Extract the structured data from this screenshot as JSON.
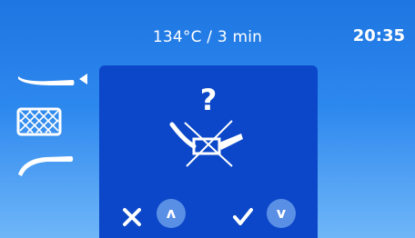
{
  "header": {
    "program": "134°C / 3 min",
    "clock": "20:35"
  },
  "sidebar": {
    "items": [
      {
        "icon": "instrument-icon",
        "selected": true
      },
      {
        "icon": "basket-icon",
        "selected": false
      },
      {
        "icon": "curved-instrument-icon",
        "selected": false
      }
    ]
  },
  "dialog": {
    "question": "?",
    "icon": "crossed-out-handpiece-icon",
    "up_label": "ʌ",
    "down_label": "v"
  },
  "colors": {
    "background_top": "#1e76e2",
    "background_bottom": "#6fb6f8",
    "dialog": "#0b47c8",
    "round_button": "#5a8fe6",
    "foreground": "#ffffff"
  }
}
